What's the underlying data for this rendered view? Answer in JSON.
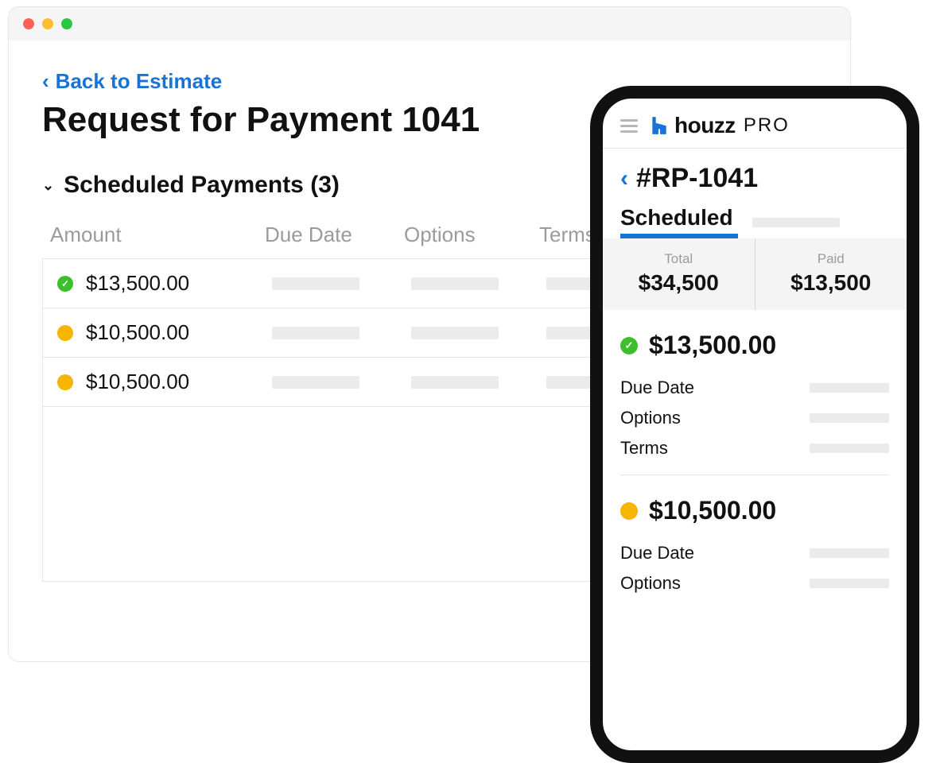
{
  "desktop": {
    "back_label": "Back to Estimate",
    "title": "Request for Payment 1041",
    "section_title": "Scheduled Payments (3)",
    "columns": {
      "amount": "Amount",
      "due": "Due Date",
      "options": "Options",
      "terms": "Terms"
    },
    "rows": [
      {
        "status": "paid",
        "amount": "$13,500.00"
      },
      {
        "status": "pending",
        "amount": "$10,500.00"
      },
      {
        "status": "pending",
        "amount": "$10,500.00"
      }
    ]
  },
  "mobile": {
    "brand": {
      "name": "houzz",
      "suffix": "PRO"
    },
    "title": "#RP-1041",
    "active_tab": "Scheduled",
    "summary": {
      "total_label": "Total",
      "total_value": "$34,500",
      "paid_label": "Paid",
      "paid_value": "$13,500"
    },
    "field_labels": {
      "due": "Due Date",
      "options": "Options",
      "terms": "Terms"
    },
    "cards": [
      {
        "status": "paid",
        "amount": "$13,500.00",
        "show_fields": [
          "due",
          "options",
          "terms"
        ]
      },
      {
        "status": "pending",
        "amount": "$10,500.00",
        "show_fields": [
          "due",
          "options"
        ]
      }
    ]
  },
  "colors": {
    "accent": "#1773D6",
    "paid": "#3DBF2C",
    "pending": "#F6B500"
  }
}
